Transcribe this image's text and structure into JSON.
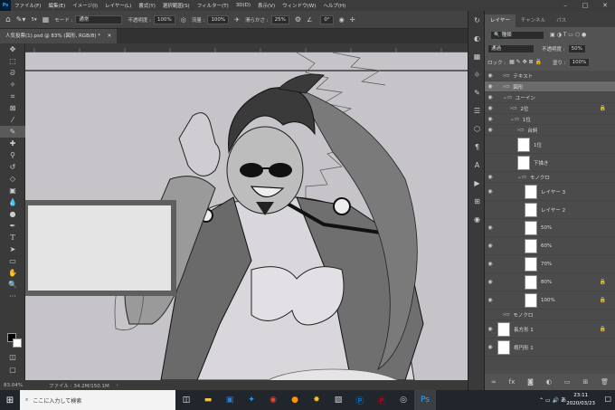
{
  "menubar": {
    "logo": "Ps",
    "items": [
      "ファイル(F)",
      "編集(E)",
      "イメージ(I)",
      "レイヤー(L)",
      "書式(Y)",
      "選択範囲(S)",
      "フィルター(T)",
      "3D(D)",
      "表示(V)",
      "ウィンドウ(W)",
      "ヘルプ(H)"
    ]
  },
  "options": {
    "brush_size": "5",
    "mode_label": "モード :",
    "mode_value": "通常",
    "opacity_label": "不透明度 :",
    "opacity_value": "100%",
    "flow_label": "流量 :",
    "flow_value": "100%",
    "smoothing_label": "滑らかさ :",
    "smoothing_value": "25%",
    "angle_value": "0°"
  },
  "document": {
    "tab_title": "人気投票(1).psd @ 83% (図形, RGB/8) *"
  },
  "status": {
    "zoom": "83.04%",
    "file_info": "ファイル : 34.2M/150.1M"
  },
  "layers_panel": {
    "tabs": [
      "レイヤー",
      "チャンネル",
      "パス"
    ],
    "kind_label": "種類",
    "blend_mode": "通過",
    "opacity_label": "不透明度 :",
    "opacity_value": "50%",
    "lock_label": "ロック :",
    "fill_label": "塗り :",
    "fill_value": "100%",
    "layers": [
      {
        "name": "テキスト",
        "type": "folder"
      },
      {
        "name": "図形",
        "type": "folder",
        "selected": true
      },
      {
        "name": "ユーイン",
        "type": "folder"
      },
      {
        "name": "2位",
        "type": "folder",
        "locked": true
      },
      {
        "name": "1位",
        "type": "folder"
      },
      {
        "name": "台詞",
        "type": "folder"
      },
      {
        "name": "1位",
        "type": "layer"
      },
      {
        "name": "下描き",
        "type": "layer"
      },
      {
        "name": "モノクロ",
        "type": "folder"
      },
      {
        "name": "レイヤー 3",
        "type": "layer"
      },
      {
        "name": "レイヤー 2",
        "type": "layer"
      },
      {
        "name": "50%",
        "type": "layer"
      },
      {
        "name": "60%",
        "type": "layer"
      },
      {
        "name": "70%",
        "type": "layer"
      },
      {
        "name": "80%",
        "type": "layer",
        "locked": true
      },
      {
        "name": "100%",
        "type": "layer",
        "locked": true
      },
      {
        "name": "モノクロ",
        "type": "folder"
      },
      {
        "name": "長方形 1",
        "type": "layer",
        "locked": true
      },
      {
        "name": "楕円形 1",
        "type": "layer"
      }
    ]
  },
  "taskbar": {
    "search_placeholder": "ここに入力して検索",
    "time": "23:11",
    "date": "2020/03/23"
  }
}
